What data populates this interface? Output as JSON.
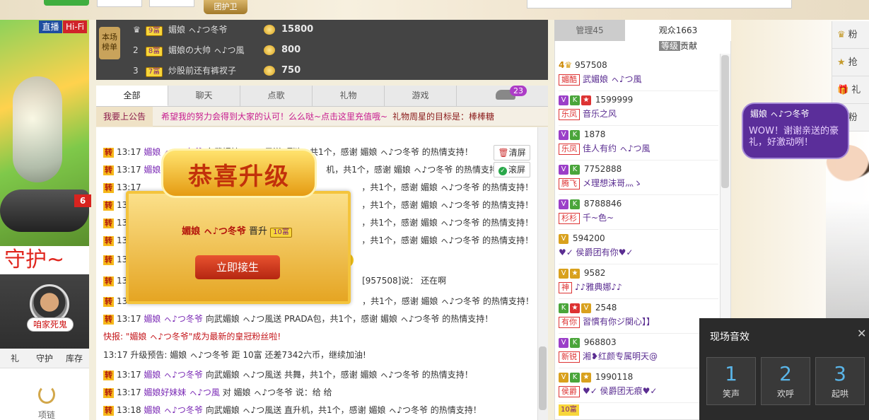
{
  "top": {
    "guard_badge": "团护卫"
  },
  "left": {
    "tag_live": "直播",
    "tag_hifi": "Hi-Fi",
    "logo": "6",
    "guard_title": "守护~",
    "guard_name": "咱家死鬼",
    "tabs": [
      "礼",
      "守护",
      "库存"
    ],
    "item_label": "项链"
  },
  "rank": {
    "ribbon": "本场榜单",
    "rows": [
      {
        "num": "",
        "level": "9富",
        "name": "媚娘 ㇸ♪つ冬爷",
        "value": "15800"
      },
      {
        "num": "2",
        "level": "8富",
        "name": "媚娘の大帅 ㇸ♪つ風",
        "value": "800"
      },
      {
        "num": "3",
        "level": "7富",
        "name": "炒股前还有裤衩子",
        "value": "750"
      }
    ]
  },
  "chat": {
    "tabs": [
      "全部",
      "聊天",
      "点歌",
      "礼物",
      "游戏"
    ],
    "car_count": "23",
    "notice_button": "我要上公告",
    "notice_text": "希望我的努力会得到大家的认可！么么哒~点击这里充值哦~",
    "notice_goal": "礼物周星的目标是：棒棒糖",
    "clear_label": "清屏",
    "scroll_label": "滚屏",
    "lines": [
      {
        "zhuan": "转",
        "time": "13:17",
        "nick": "媚娘 ㇸ♪つ冬爷",
        "text": "向武媚娘 ㇸ♪つ風送 项链，共1个，感谢 媚娘 ㇸ♪つ冬爷 的热情支持！"
      },
      {
        "zhuan": "转",
        "time": "13:17",
        "nick": "媚娘",
        "text": "机，共1个，感谢 媚娘 ㇸ♪つ冬爷 的热情支持！"
      },
      {
        "zhuan": "转",
        "time": "13:17",
        "nick": "",
        "text": "，共1个，感谢 媚娘 ㇸ♪つ冬爷 的热情支持！"
      },
      {
        "zhuan": "转",
        "time": "13:17",
        "nick": "",
        "text": "，共1个，感谢 媚娘 ㇸ♪つ冬爷 的热情支持！"
      },
      {
        "zhuan": "转",
        "time": "13:17",
        "nick": "",
        "text": "，共1个，感谢 媚娘 ㇸ♪つ冬爷 的热情支持！"
      },
      {
        "zhuan": "转",
        "time": "13:17",
        "nick": "",
        "text": "，共1个，感谢 媚娘 ㇸ♪つ冬爷 的热情支持！"
      },
      {
        "zhuan": "转",
        "time": "13",
        "nick": "",
        "text": ""
      },
      {
        "zhuan": "转",
        "time": "13",
        "nick": "",
        "text": "[957508]说： 还在啊"
      },
      {
        "zhuan": "转",
        "time": "13",
        "nick": "",
        "text": "，共1个，感谢 媚娘 ㇸ♪つ冬爷 的热情支持！"
      },
      {
        "zhuan": "转",
        "time": "13:17",
        "nick": "媚娘 ㇸ♪つ冬爷",
        "text": "向武媚娘 ㇸ♪つ風送 PRADA包，共1个，感谢 媚娘 ㇸ♪つ冬爷 的热情支持！"
      }
    ],
    "flash": "快报: \"媚娘 ㇸ♪つ冬爷\"成为最新的皇冠粉丝啦!",
    "upgrade": "13:17 升级预告: 媚娘 ㇸ♪つ冬爷 距 10富 还差7342六币，继续加油!",
    "lines2": [
      {
        "zhuan": "转",
        "time": "13:17",
        "nick": "媚娘 ㇸ♪つ冬爷",
        "text": "向武媚娘 ㇸ♪つ風送 共舞，共1个，感谢 媚娘 ㇸ♪つ冬爷 的热情支持！"
      },
      {
        "zhuan": "转",
        "time": "13:17",
        "nick": "媚娘好妹妹 ㇸ♪つ風",
        "text": "对 媚娘 ㇸ♪つ冬爷 说：给 给"
      },
      {
        "zhuan": "转",
        "time": "13:18",
        "nick": "媚娘 ㇸ♪つ冬爷",
        "text": "向武媚娘 ㇸ♪つ風送 直升机，共1个，感谢 媚娘 ㇸ♪つ冬爷 的热情支持！"
      }
    ]
  },
  "popup": {
    "title": "恭喜升级",
    "nick": "媚娘 ㇸ♪つ冬爷",
    "msg_mid": "晋升",
    "level": "10富",
    "button": "立即接生"
  },
  "fans": {
    "tab_admin": "管理45",
    "tab_audience": "观众1663",
    "sort_level": "等级",
    "sort_contrib": "贡献",
    "items": [
      {
        "badges": "4",
        "id": "957508",
        "group": "媚酷",
        "name": "武媚娘 ㇸ♪つ風"
      },
      {
        "badges": "V K",
        "id": "1599999",
        "group": "乐凤",
        "name": "音乐之风"
      },
      {
        "badges": "V K",
        "id": "1878",
        "group": "乐凤",
        "name": "佳人有约 ㇸ♪つ風"
      },
      {
        "badges": "V K",
        "id": "7752888",
        "group": "腾飞",
        "name": "メ理想沫哥灬ゝ"
      },
      {
        "badges": "V K",
        "id": "8788846",
        "group": "杉杉",
        "name": "千~色~"
      },
      {
        "badges": "V",
        "id": "594200",
        "group": "",
        "name": "♥✓ 侯爵团有你♥✓"
      },
      {
        "badges": "V",
        "id": "9582",
        "group": "神",
        "name": "♪♪雅典娜♪♪"
      },
      {
        "badges": "K V",
        "id": "2548",
        "group": "有你",
        "name": "習慣有你ジ関心】】"
      },
      {
        "badges": "V K",
        "id": "968803",
        "group": "新锐",
        "name": "湘❥红颜专属明天@"
      },
      {
        "badges": "V K",
        "id": "1990118",
        "group": "侯爵",
        "name": "♥✓ 侯爵团无痕♥✓"
      }
    ]
  },
  "rail": [
    "粉",
    "抢",
    "礼",
    "粉"
  ],
  "bubble": {
    "name": "媚娘 ㇸ♪つ冬爷",
    "msg": "WOW！谢谢亲送的豪礼，好激动咧！"
  },
  "sound": {
    "title": "现场音效",
    "buttons": [
      {
        "n": "1",
        "label": "笑声"
      },
      {
        "n": "2",
        "label": "欢呼"
      },
      {
        "n": "3",
        "label": "起哄"
      }
    ]
  }
}
